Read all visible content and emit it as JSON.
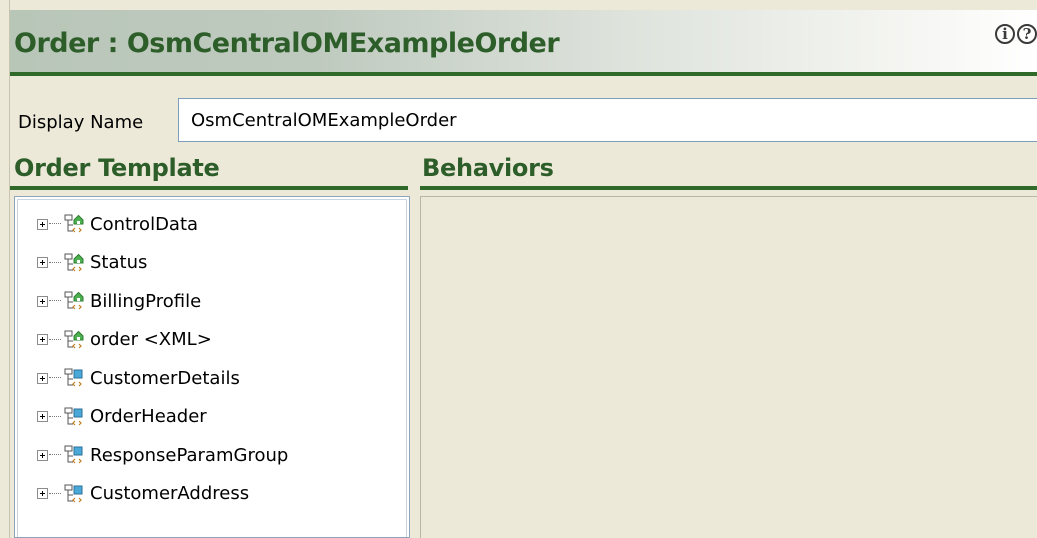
{
  "header": {
    "title": "Order : OsmCentralOMExampleOrder",
    "info_icon": "info-icon",
    "help_icon": "help-icon"
  },
  "display_name": {
    "label": "Display Name",
    "value": "OsmCentralOMExampleOrder"
  },
  "order_template": {
    "title": "Order Template",
    "items": [
      {
        "label": "ControlData",
        "icon": "green-data-node-icon"
      },
      {
        "label": "Status",
        "icon": "green-data-node-icon"
      },
      {
        "label": "BillingProfile",
        "icon": "green-data-node-icon"
      },
      {
        "label": "order <XML>",
        "icon": "green-data-node-icon"
      },
      {
        "label": "CustomerDetails",
        "icon": "blue-data-node-icon"
      },
      {
        "label": "OrderHeader",
        "icon": "blue-data-node-icon"
      },
      {
        "label": "ResponseParamGroup",
        "icon": "blue-data-node-icon"
      },
      {
        "label": "CustomerAddress",
        "icon": "blue-data-node-icon"
      }
    ]
  },
  "behaviors": {
    "title": "Behaviors"
  },
  "colors": {
    "accent_green": "#2f6a2b",
    "title_green": "#2d5e2a",
    "background": "#ece9d8"
  }
}
